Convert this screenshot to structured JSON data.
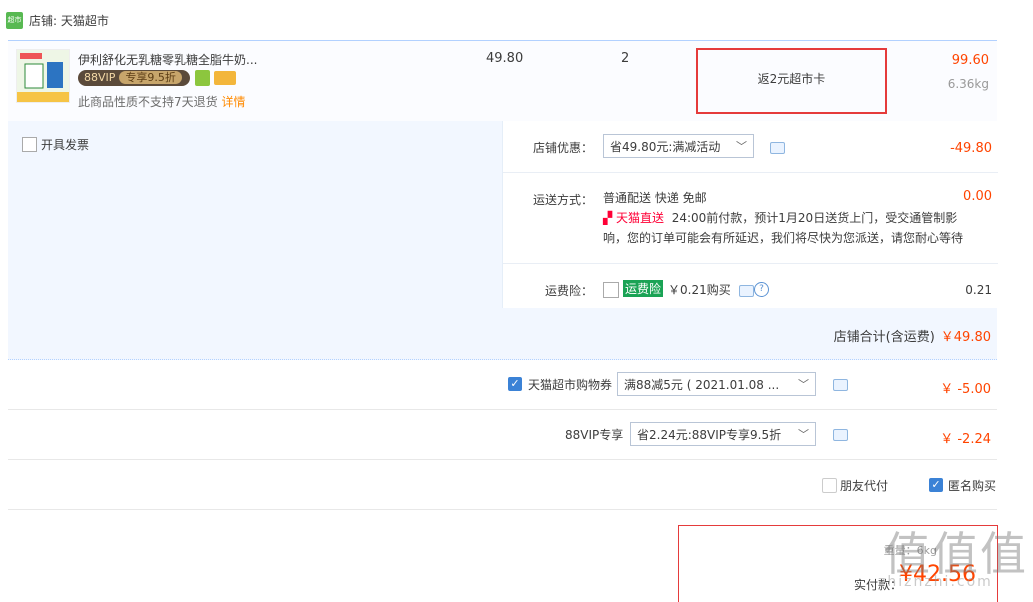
{
  "shop": {
    "icon_text": "超市",
    "label": "店铺: 天猫超市"
  },
  "item": {
    "title": "伊利舒化无乳糖零乳糖全脂牛奶...",
    "vip_text": "88VIP",
    "vip_tag": "专享9.5折",
    "no_return": "此商品性质不支持7天退货",
    "detail_link": "详情",
    "price": "49.80",
    "qty": "2",
    "rebate": "返2元超市卡",
    "total": "99.60",
    "weight": "6.36kg"
  },
  "invoice": {
    "label": "开具发票"
  },
  "discount": {
    "label": "店铺优惠：",
    "select": "省49.80元:满减活动",
    "value": "-49.80"
  },
  "shipping": {
    "label": "运送方式：",
    "method": "普通配送 快递 免邮",
    "value": "0.00",
    "tmall_tag": "天猫直送",
    "note1": "24:00前付款，预计1月20日送货上门，受交通管制影",
    "note2": "响，您的订单可能会有所延迟，我们将尽快为您派送，请您耐心等待"
  },
  "insurance": {
    "label": "运费险：",
    "tag": "运费险",
    "price": "￥0.21购买",
    "value": "0.21"
  },
  "shop_total": {
    "label": "店铺合计(含运费)",
    "value": "￥49.80"
  },
  "coupon": {
    "label": "天猫超市购物券",
    "select": "满88减5元 ( 2021.01.08 ...",
    "value": "￥ -5.00"
  },
  "vip": {
    "label": "88VIP专享",
    "select": "省2.24元:88VIP专享9.5折",
    "value": "￥ -2.24"
  },
  "options": {
    "friend_pay": "朋友代付",
    "anonymous": "匿名购买"
  },
  "payment": {
    "weight_partial": "重量：6kg",
    "label": "实付款：",
    "amount": "¥42.56"
  },
  "watermark": {
    "text": "值值值",
    "sub": "zhiznzhi.com"
  },
  "colors": {
    "price_red": "#ff4400",
    "header_blue": "#b2d1ff",
    "panel_bg": "#f2f7ff"
  }
}
